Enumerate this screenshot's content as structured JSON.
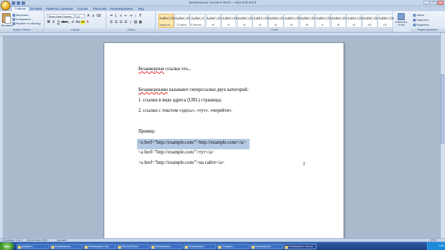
{
  "window": {
    "title": "Безанкорные ссылки в Word — Microsoft Word"
  },
  "tabs": [
    "Главная",
    "Вставка",
    "Разметка страницы",
    "Ссылки",
    "Рассылки",
    "Рецензирование",
    "Вид"
  ],
  "ribbon": {
    "clipboard": {
      "paste": "Вставить",
      "cut": "Вырезать",
      "copy": "Копировать",
      "format_painter": "Формат по образцу",
      "label": "Буфер обмена"
    },
    "font": {
      "name": "Times New Roman",
      "size": "12",
      "label": "Шрифт"
    },
    "paragraph": {
      "label": "Абзац"
    },
    "styles": {
      "label": "Стили",
      "items": [
        {
          "sample": "AaBbCcDt",
          "name": "apple-con..."
        },
        {
          "sample": "AaBbCcDt",
          "name": "¶ Caption"
        },
        {
          "sample": "AaBbCcI",
          "name": "¶ Informal_..."
        },
        {
          "sample": "AaBbCcDt",
          "name": "s0"
        },
        {
          "sample": "AaBbCcDt",
          "name": "s1"
        },
        {
          "sample": "AaBbCcDt",
          "name": "s2"
        },
        {
          "sample": "AaBbCcDt",
          "name": "s3"
        },
        {
          "sample": "AaBbCcDt",
          "name": "s4"
        },
        {
          "sample": "AaBbCcDt",
          "name": "s5"
        },
        {
          "sample": "AaBbCcDt",
          "name": "s6"
        },
        {
          "sample": "AaBbCcDt",
          "name": "s7"
        },
        {
          "sample": "AaBbCcDt",
          "name": "s8"
        },
        {
          "sample": "AaBbCcDt",
          "name": "s9"
        },
        {
          "sample": "AaBbCcDt",
          "name": "s10"
        },
        {
          "sample": "AaBbCcDt",
          "name": "s11"
        }
      ],
      "change_styles": "Изменить стили"
    },
    "editing": {
      "find": "Найти",
      "replace": "Заменить",
      "select": "Выделить",
      "label": "Редактирование"
    }
  },
  "document": {
    "title_pre": "Безанкорные",
    "title_post": " ссылки это...",
    "intro_pre": "Безанкорными",
    "intro_post": " называют гиперссылки двух категорий:",
    "item1": "1. ссылки в виде адреса (URL) страницы;",
    "item2": "2. ссылки с текстом «здесь», «тут», «перейти».",
    "example_label": "Пример:",
    "code1": "<a href=\"http://example.com/\">http://example.com/</a>",
    "code2": "<a href=\"http://example.com/\">тут</a>",
    "code3": "<a href=\"http://example.com/\">на сайте</a>"
  },
  "status": {
    "page": "Страница: 1 из 1",
    "words": "Число слов: 2/36",
    "lang": "русский",
    "zoom": "100%"
  },
  "taskbar": {
    "start": "пуск",
    "items": [
      "Документ...",
      "Безанкорные...",
      "Безанкорные ссы...",
      "Microsoft Word",
      "Безанкорные...",
      "Безанкорные...",
      "Стандарт...",
      "Безанкорные...",
      "Безанкорные ссылки..."
    ],
    "clock": "1:26"
  },
  "colors": {
    "selection": "#b5c9e2",
    "spellcheck": "#e02020",
    "taskbar": "#2f5da8"
  }
}
